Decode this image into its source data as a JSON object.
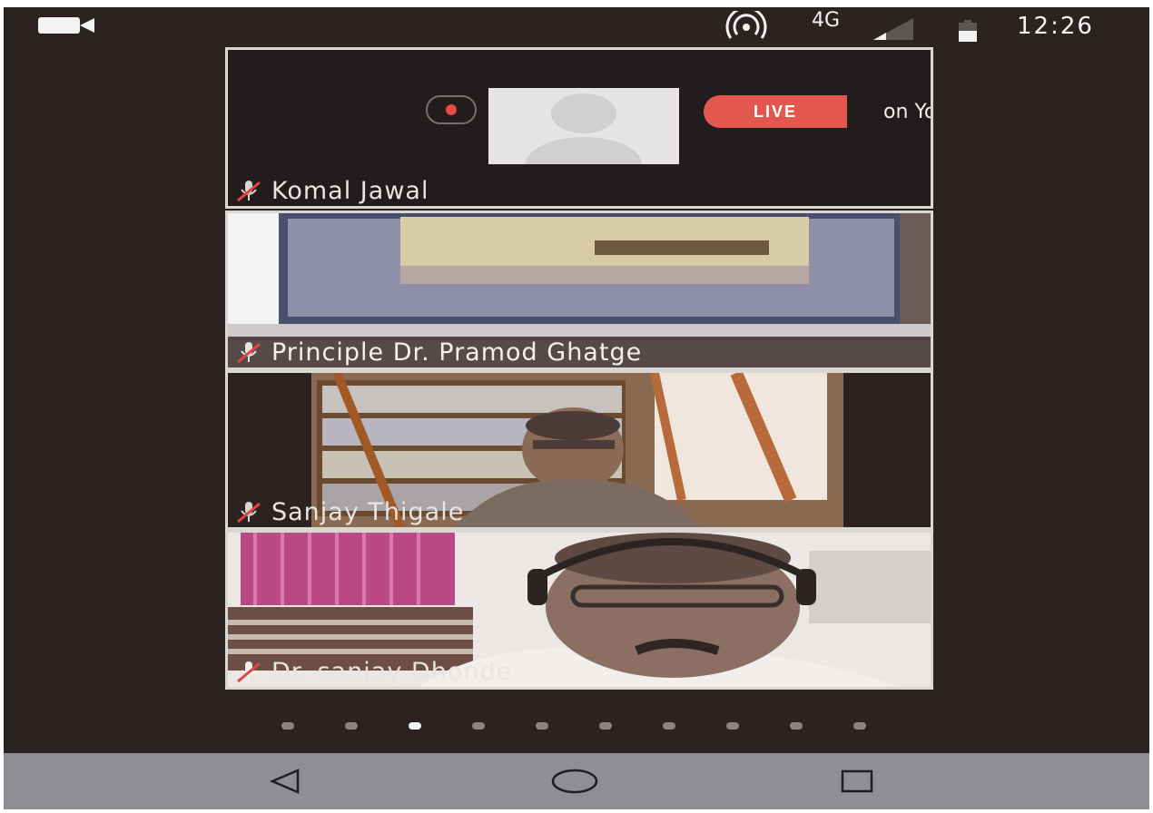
{
  "status_bar": {
    "network": "4G",
    "time": "12:26"
  },
  "tiles": [
    {
      "participant": "Komal Jawal",
      "live_badge": "LIVE",
      "live_suffix": "on YouTube"
    },
    {
      "participant": "Principle Dr. Pramod Ghatge"
    },
    {
      "participant": "Sanjay Thigale"
    },
    {
      "participant": "Dr. sanjay Dhonde"
    }
  ],
  "pager": {
    "page_count": 10,
    "current_page": 3
  },
  "colors": {
    "background": "#2a2322",
    "live_badge": "#e2584f",
    "nav_bar": "#8e8e93",
    "dot_active": "#f4f4f4",
    "dot_inactive": "#8c8483"
  },
  "icons": {
    "status": [
      "video-camera-icon",
      "hotspot-icon",
      "signal-icon",
      "battery-icon"
    ],
    "tile": [
      "muted-mic-icon",
      "record-icon"
    ],
    "nav": [
      "back-icon",
      "home-icon",
      "recents-icon"
    ]
  }
}
